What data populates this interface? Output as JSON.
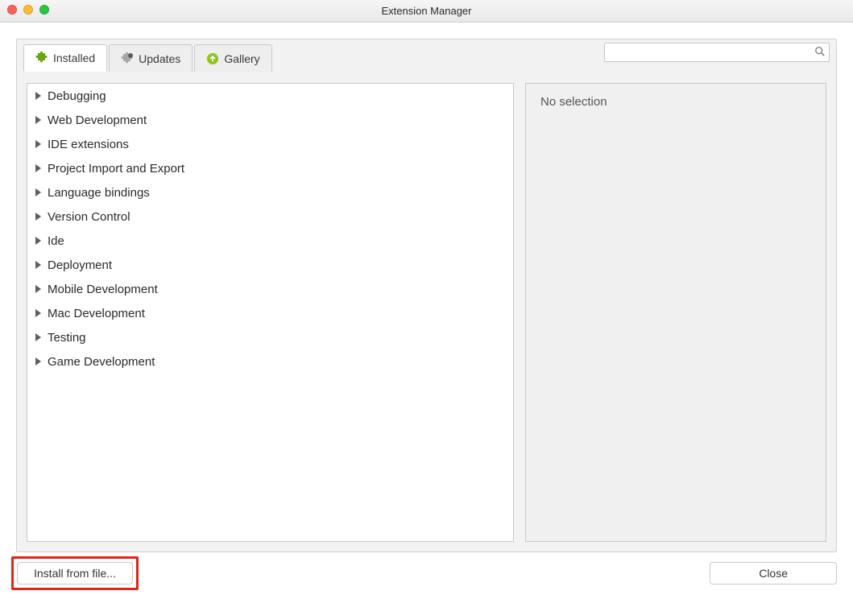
{
  "window": {
    "title": "Extension Manager"
  },
  "tabs": [
    {
      "label": "Installed",
      "active": true,
      "icon": "puzzle"
    },
    {
      "label": "Updates",
      "active": false,
      "icon": "puzzle-update"
    },
    {
      "label": "Gallery",
      "active": false,
      "icon": "arrow-up-circle"
    }
  ],
  "search": {
    "value": ""
  },
  "categories": [
    "Debugging",
    "Web Development",
    "IDE extensions",
    "Project Import and Export",
    "Language bindings",
    "Version Control",
    "Ide",
    "Deployment",
    "Mobile Development",
    "Mac Development",
    "Testing",
    "Game Development"
  ],
  "detail": {
    "placeholder": "No selection"
  },
  "buttons": {
    "install_from_file": "Install from file...",
    "close": "Close"
  }
}
